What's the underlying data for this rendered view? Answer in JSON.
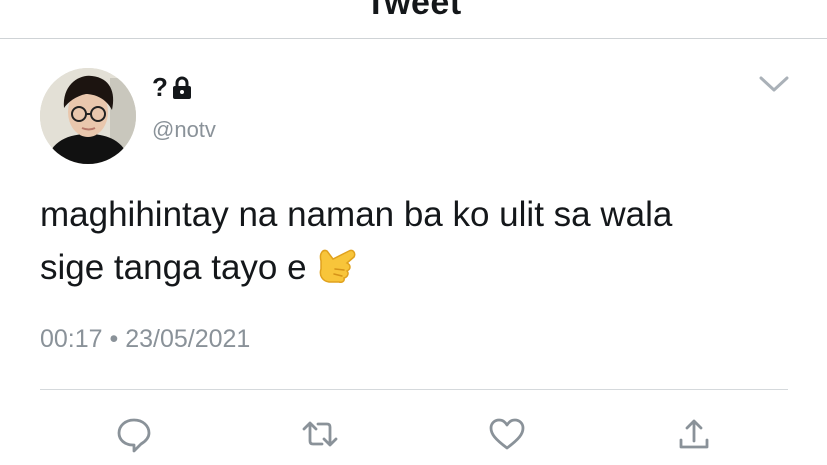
{
  "header": {
    "title": "Tweet"
  },
  "user": {
    "display_name": "?",
    "handle": "@notv"
  },
  "tweet": {
    "lines": [
      "maghihintay na naman ba ko ulit sa wala",
      "sige tanga tayo e"
    ],
    "emoji": "call-me-hand",
    "time": "00:17",
    "date": "23/05/2021"
  },
  "colors": {
    "accent": "#1da1f2",
    "muted": "#8a9299",
    "text": "#14171a"
  }
}
